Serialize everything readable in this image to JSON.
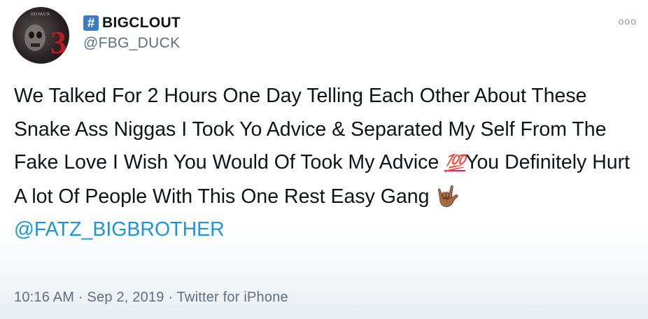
{
  "user": {
    "badge": "#",
    "name": "BIGCLOUT",
    "handle": "@FBG_DUCK",
    "avatar_text": "DO DUCK",
    "avatar_numeral": "3"
  },
  "more_menu": "ooo",
  "tweet": {
    "text_part1": "We Talked For 2 Hours One Day Telling Each Other About These Snake Ass Niggas I Took Yo Advice & Separated My Self From The Fake Love I Wish You Would Of Took My Advice ",
    "emoji_100": "💯",
    "text_part2": "You Definitely Hurt A lot Of People With This One Rest Easy Gang ",
    "emoji_hand": "🤟🏾",
    "mention": "@FATZ_BIGBROTHER"
  },
  "meta": {
    "time": "10:16 AM",
    "date": "Sep 2, 2019",
    "source": "Twitter for iPhone"
  }
}
